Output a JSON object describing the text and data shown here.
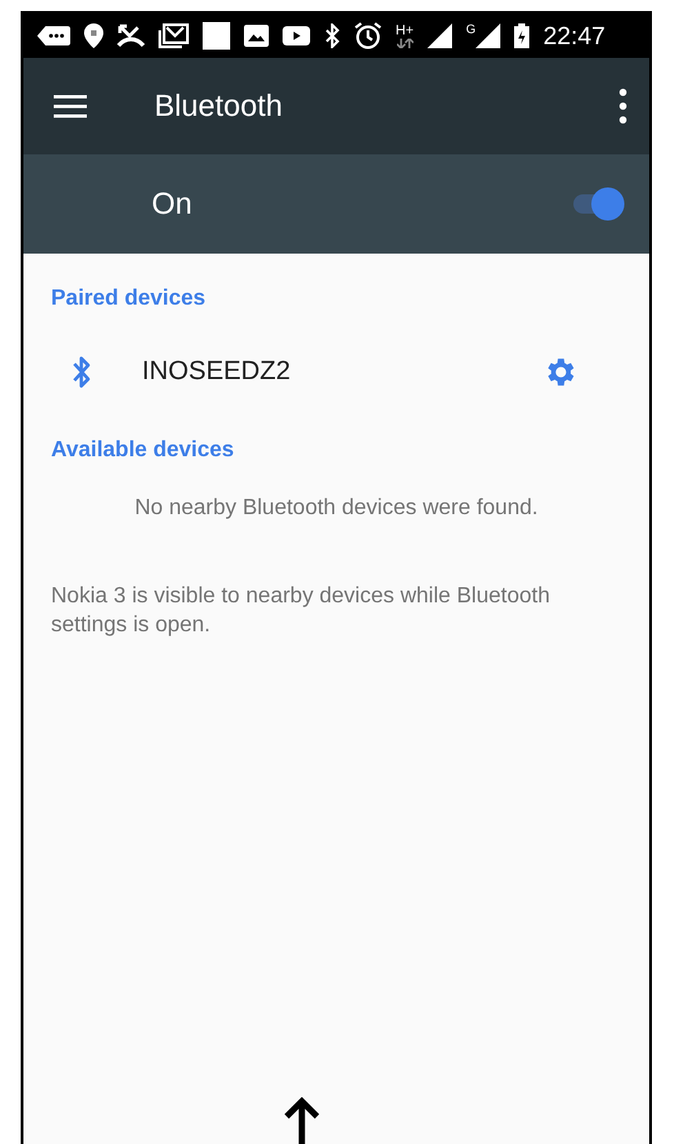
{
  "status_bar": {
    "network_type": "H+",
    "second_network": "G",
    "time": "22:47"
  },
  "toolbar": {
    "title": "Bluetooth"
  },
  "master_switch": {
    "label": "On",
    "on": true
  },
  "sections": [
    {
      "kind": "paired",
      "header": "Paired devices",
      "devices": [
        {
          "name": "INOSEEDZ2"
        }
      ]
    },
    {
      "kind": "available",
      "header": "Available devices",
      "empty_message": "No nearby Bluetooth devices were found."
    }
  ],
  "footer_note": "Nokia 3 is visible to nearby devices while Bluetooth settings is open."
}
